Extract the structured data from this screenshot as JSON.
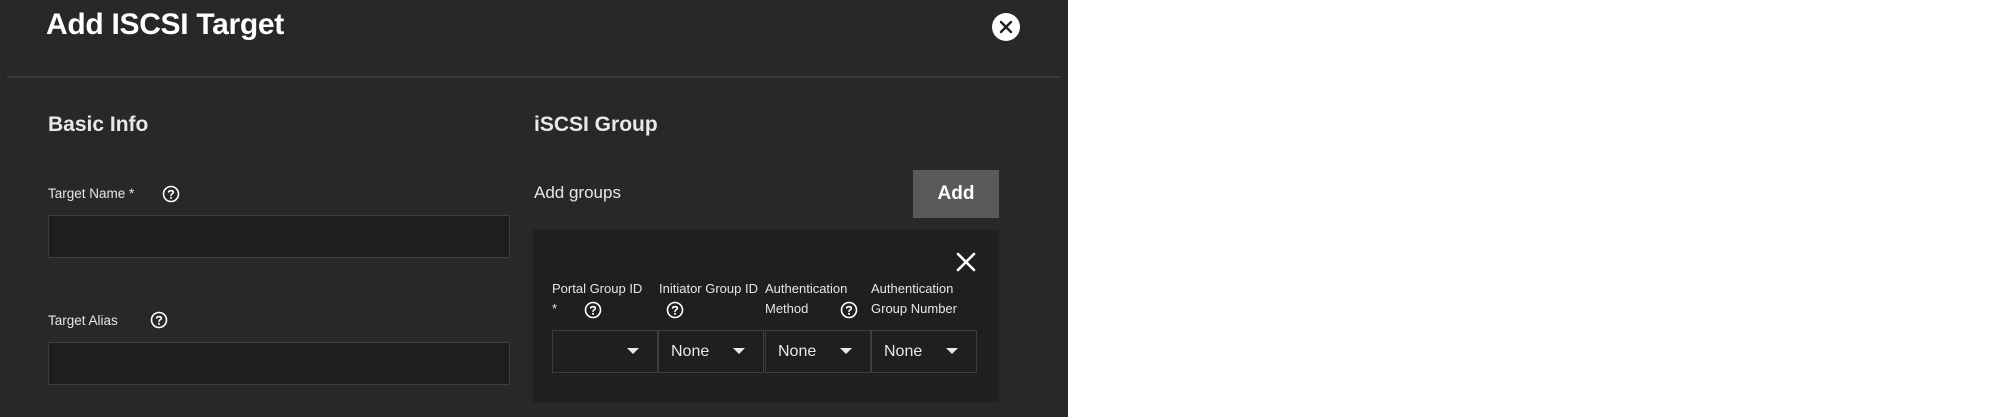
{
  "dialog": {
    "title": "Add ISCSI Target"
  },
  "icons": {
    "close": "close-icon",
    "help": "help-circle-icon",
    "caret": "chevron-down-icon",
    "remove": "x-icon"
  },
  "basic_info": {
    "section_title": "Basic Info",
    "target_name": {
      "label": "Target Name *",
      "value": ""
    },
    "target_alias": {
      "label": "Target Alias",
      "value": ""
    }
  },
  "iscsi_group": {
    "section_title": "iSCSI Group",
    "add_groups_label": "Add groups",
    "add_button_label": "Add",
    "group": {
      "portal_group": {
        "label_line1": "Portal Group ID",
        "label_line2": "*",
        "value": ""
      },
      "initiator_group": {
        "label_line1": "Initiator Group ID",
        "label_line2": "",
        "value": "None"
      },
      "auth_method": {
        "label_line1": "Authentication",
        "label_line2": "Method",
        "value": "None"
      },
      "auth_group": {
        "label_line1": "Authentication",
        "label_line2": "Group Number",
        "value": "None"
      }
    }
  },
  "colors": {
    "dialog_bg": "#282828",
    "input_bg": "#1e1e1e",
    "card_bg": "#1f1f1f",
    "button_bg": "#5a5a5a",
    "text": "#ffffff"
  }
}
